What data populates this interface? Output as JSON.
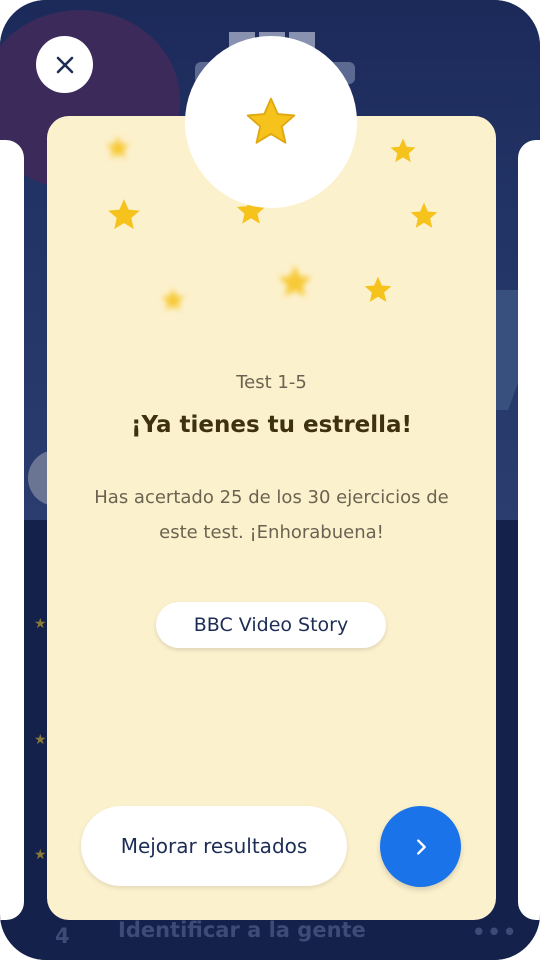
{
  "background": {
    "row_number": "4",
    "row_title": "Identificar a la gente",
    "row_more": "•••"
  },
  "close": {
    "icon": "close-icon"
  },
  "card": {
    "test_label": "Test 1-5",
    "headline": "¡Ya tienes tu estrella!",
    "description": "Has acertado 25 de los 30 ejercicios de este test. ¡Enhorabuena!",
    "story_chip": "BBC Video Story",
    "improve_button": "Mejorar resultados",
    "next_icon": "chevron-right-icon"
  },
  "colors": {
    "card_bg": "#fcf1cd",
    "star": "#f6c21c",
    "primary": "#1a73e8",
    "text_dark": "#1d2d55"
  }
}
